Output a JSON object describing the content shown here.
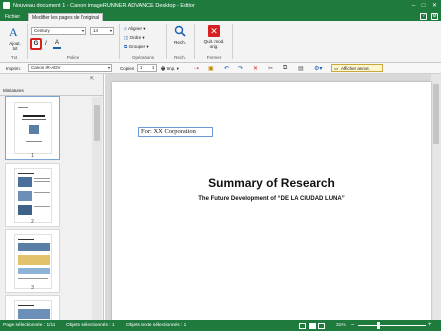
{
  "window": {
    "title": "Nouveau document 1 - Canon imageRUNNER ADVANCE Desktop - Editor"
  },
  "tabs": [
    {
      "label": "Fichier"
    },
    {
      "label": "Modifier les pages de l'original"
    }
  ],
  "ribbon": {
    "text_group": {
      "button": "Ajout. txt",
      "label": "Txt"
    },
    "font_group": {
      "font_name": "Century",
      "font_size": "14",
      "bold": "G",
      "italic": "I",
      "underline": "A",
      "label": "Police"
    },
    "operations_group": {
      "align": "Aligner",
      "order": "Ordre",
      "group": "Grouper",
      "label": "Opérations"
    },
    "search_group": {
      "button": "Rech.",
      "label": "Rech."
    },
    "close_group": {
      "button": "Quit. mod. orig.",
      "label": "Fermer"
    }
  },
  "toolbar": {
    "printer_label": "Imprim.",
    "printer_value": "Canon iR-ADV",
    "copies_label": "Copies",
    "copies_value": "1",
    "print_button": "Imp.",
    "show_annotations": "Afficher annot."
  },
  "panel": {
    "title": "Miniatures",
    "pages": [
      "1",
      "2",
      "3"
    ]
  },
  "document": {
    "label_box": "For: XX Corporation",
    "heading": "Summary of Research",
    "subheading": "The Future Development of “DE LA CIUDAD LUNA”"
  },
  "status": {
    "page_selected": "Page sélectionnée : 1/11",
    "objects_selected": "Objets sélectionnés : 1",
    "text_objects_selected": "Objets texte sélectionnés : 1",
    "zoom": "31%"
  }
}
